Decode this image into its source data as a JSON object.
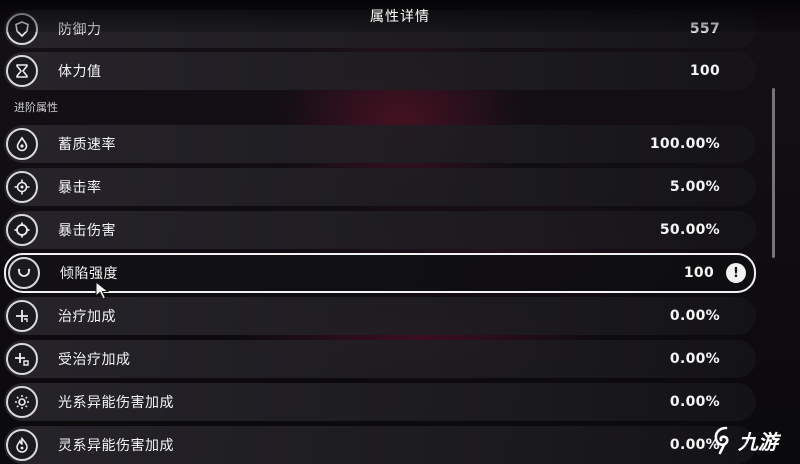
{
  "header": {
    "title": "属性详情"
  },
  "section": {
    "advanced_title": "进阶属性"
  },
  "rows": [
    {
      "label": "防御力",
      "value": "557",
      "icon": "shield-icon"
    },
    {
      "label": "体力值",
      "value": "100",
      "icon": "hourglass-icon"
    },
    {
      "label": "蓄质速率",
      "value": "100.00%",
      "icon": "drop-icon"
    },
    {
      "label": "暴击率",
      "value": "5.00%",
      "icon": "crosshair-icon"
    },
    {
      "label": "暴击伤害",
      "value": "50.00%",
      "icon": "target-icon"
    },
    {
      "label": "倾陷强度",
      "value": "100",
      "icon": "smile-arc-icon",
      "alert": "!"
    },
    {
      "label": "治疗加成",
      "value": "0.00%",
      "icon": "heal-plus-icon"
    },
    {
      "label": "受治疗加成",
      "value": "0.00%",
      "icon": "receive-heal-icon"
    },
    {
      "label": "光系异能伤害加成",
      "value": "0.00%",
      "icon": "sun-icon"
    },
    {
      "label": "灵系异能伤害加成",
      "value": "0.00%",
      "icon": "flame-icon"
    }
  ],
  "watermark": {
    "text": "九游"
  }
}
